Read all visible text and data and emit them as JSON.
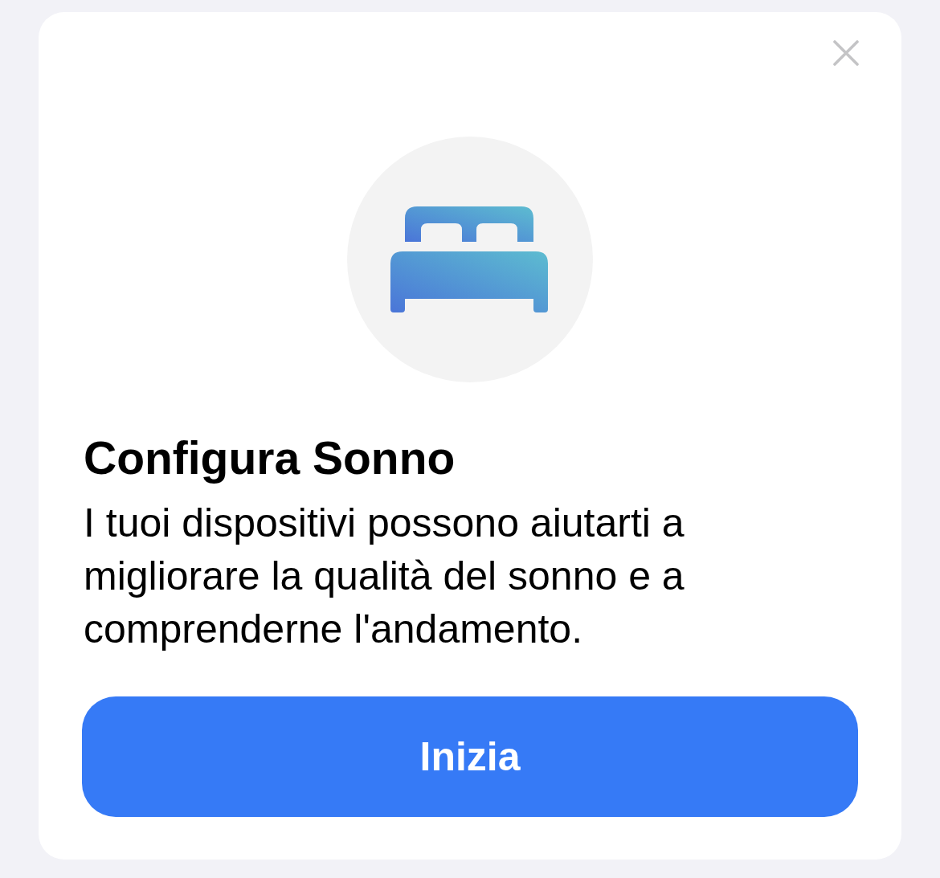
{
  "card": {
    "title": "Configura Sonno",
    "description": "I tuoi dispositivi possono aiutarti a migliorare la qualità del sonno e a comprenderne l'andamento.",
    "button": {
      "label": "Inizia"
    }
  }
}
